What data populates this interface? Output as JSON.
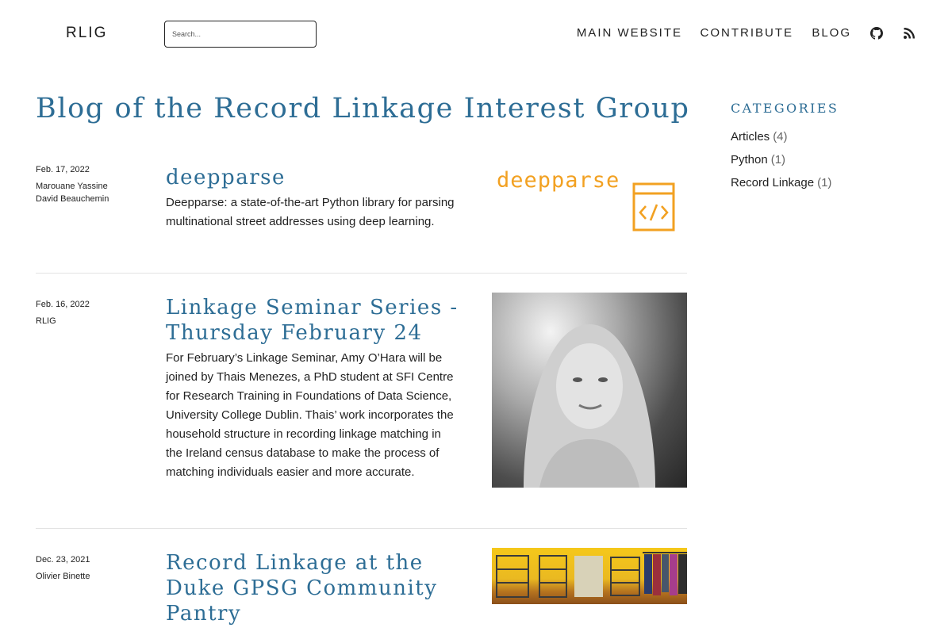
{
  "header": {
    "brand": "RLIG",
    "search_placeholder": "Search...",
    "nav": {
      "main_website": "MAIN WEBSITE",
      "contribute": "CONTRIBUTE",
      "blog": "BLOG",
      "icons": [
        "github-icon",
        "rss-icon"
      ]
    }
  },
  "page": {
    "title": "Blog of the Record Linkage Interest Group"
  },
  "posts": [
    {
      "date": "Feb. 17, 2022",
      "authors": [
        "Marouane Yassine",
        "David Beauchemin"
      ],
      "title": "deepparse",
      "excerpt": "Deepparse: a state-of-the-art Python library for parsing multinational street addresses using deep learning.",
      "thumbnail": {
        "logo_text": "deepparse",
        "accent": "#f2a122"
      }
    },
    {
      "date": "Feb. 16, 2022",
      "authors": [
        "RLIG"
      ],
      "title": "Linkage Seminar Series - Thursday February 24",
      "excerpt": "For February’s Linkage Seminar, Amy O’Hara will be joined by Thais Menezes, a PhD student at SFI Centre for Research Training in Foundations of Data Science, University College Dublin. Thais’ work incorporates the household structure in recording linkage matching in the Ireland census database to make the process of matching individuals easier and more accurate.",
      "thumbnail": {}
    },
    {
      "date": "Dec. 23, 2021",
      "authors": [
        "Olivier Binette"
      ],
      "title": "Record Linkage at the Duke GPSG Community Pantry",
      "excerpt": "",
      "thumbnail": {}
    }
  ],
  "sidebar": {
    "heading": "CATEGORIES",
    "categories": [
      {
        "label": "Articles",
        "count": "(4)"
      },
      {
        "label": "Python",
        "count": "(1)"
      },
      {
        "label": "Record Linkage",
        "count": "(1)"
      }
    ]
  },
  "colors": {
    "accent_blue": "#2d6d95",
    "text": "#222222",
    "divider": "#e3e3e3",
    "deepparse_orange": "#f2a122"
  }
}
